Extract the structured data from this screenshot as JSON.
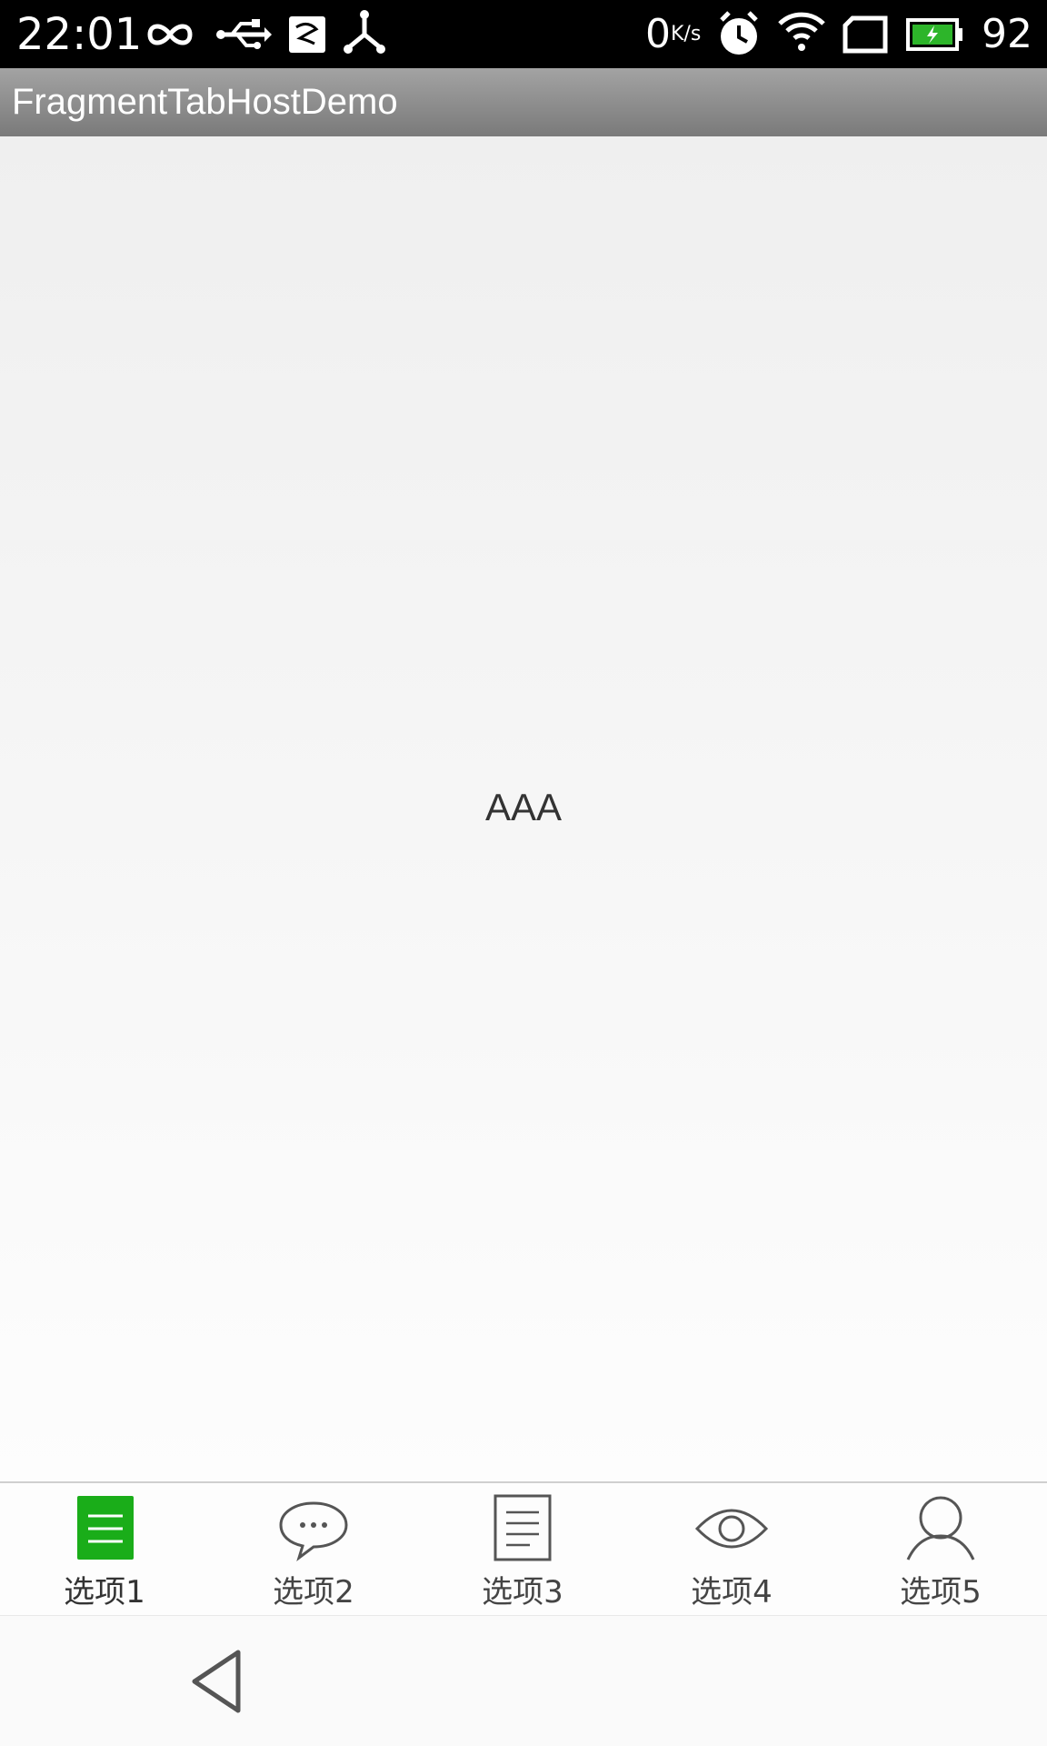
{
  "status_bar": {
    "time": "22:01",
    "speed_value": "0",
    "speed_unit": "K/s",
    "battery_level": "92",
    "icons": [
      "infinity-icon",
      "usb-icon",
      "notification-app-icon",
      "share-icon",
      "alarm-icon",
      "wifi-icon",
      "sim-icon",
      "battery-icon"
    ]
  },
  "action_bar": {
    "title": "FragmentTabHostDemo"
  },
  "content": {
    "text": "AAA"
  },
  "tabs": [
    {
      "label": "选项1",
      "icon": "document-icon",
      "selected": true
    },
    {
      "label": "选项2",
      "icon": "chat-bubble-icon",
      "selected": false
    },
    {
      "label": "选项3",
      "icon": "note-icon",
      "selected": false
    },
    {
      "label": "选项4",
      "icon": "eye-icon",
      "selected": false
    },
    {
      "label": "选项5",
      "icon": "person-icon",
      "selected": false
    }
  ],
  "colors": {
    "accent": "#1aad19",
    "icon_gray": "#555555"
  }
}
